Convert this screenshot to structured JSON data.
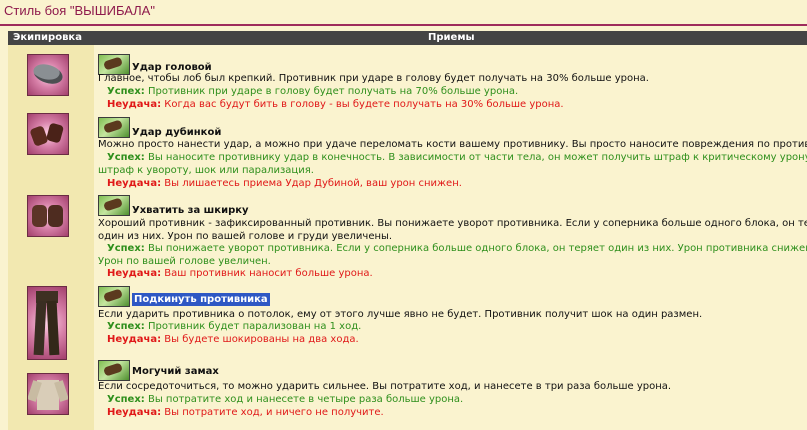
{
  "page_title": "Стиль боя \"ВЫШИБАЛА\"",
  "columns": {
    "equipment": "Экипировка",
    "techniques": "Приемы"
  },
  "success_label": "Успех:",
  "fail_label": "Неудача:",
  "techniques": [
    {
      "name": "Удар головой",
      "description": "Главное, чтобы лоб был крепкий. Противник при ударе в голову будет получать на 30% больше урона.",
      "success": "Противник при ударе в голову будет получать на 70% больше урона.",
      "fail": "Когда вас будут бить в голову - вы будете получать на 30% больше урона.",
      "equipment_icon": "helmet-icon"
    },
    {
      "name": "Удар дубинкой",
      "description": "Можно просто нанести удар, а можно при удаче переломать кости вашему противнику. Вы просто наносите повреждения по противнику.",
      "success_line1": "Вы наносите противнику удар в конечность. В зависимости от части тела, он может получить штраф к критическому урону,",
      "success_line2": "штраф к увороту, шок или парализация.",
      "fail": "Вы лишаетесь приема Удар Дубиной, ваш урон снижен.",
      "equipment_icon": "bracers-icon"
    },
    {
      "name": "Ухватить за шкирку",
      "description_line1": "Хороший противник - зафиксированный противник. Вы понижаете уворот противника. Если у соперника больше одного блока, он теряет",
      "description_line2": "один из них. Урон по вашей голове и груди увеличены.",
      "success_line1": "Вы понижаете уворот противника. Если у соперника больше одного блока, он теряет один из них. Урон противника снижен.",
      "success_line2": "Урон по вашей голове увеличен.",
      "fail": "Ваш противник наносит больше урона.",
      "equipment_icon": "gloves-icon"
    },
    {
      "name": "Подкинуть противника",
      "description": "Если ударить противника о потолок, ему от этого лучше явно не будет. Противник получит шок на один размен.",
      "success": "Противник будет парализован на 1 ход.",
      "fail": "Вы будете шокированы на два хода.",
      "equipment_icon": "pants-icon"
    },
    {
      "name": "Могучий замах",
      "description": "Если сосредоточиться, то можно ударить сильнее. Вы потратите ход, и нанесете в три раза больше урона.",
      "success": "Вы потратите ход и нанесете в четыре раза больше урона.",
      "fail": "Вы потратите ход, и ничего не получите.",
      "equipment_icon": "shirt-icon"
    }
  ]
}
